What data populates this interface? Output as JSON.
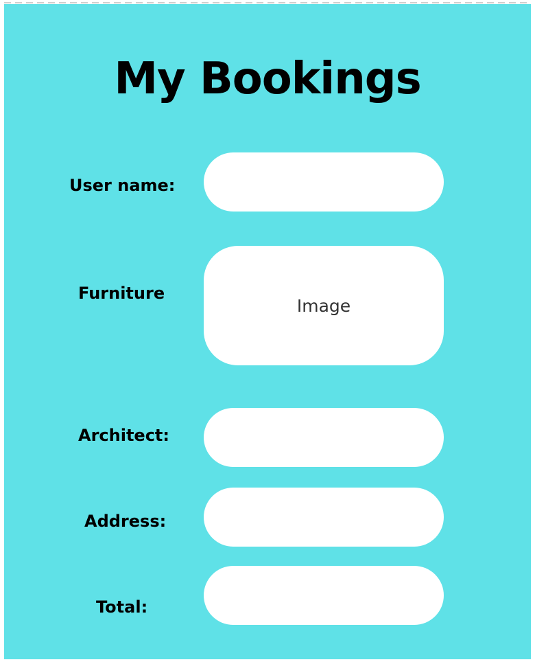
{
  "page": {
    "title": "My Bookings",
    "background_color": "#5fe1e7",
    "field_color": "#ffffff"
  },
  "form": {
    "username_label": "User name:",
    "username_value": "",
    "furniture_label": "Furniture",
    "furniture_image_text": "Image",
    "architect_label": "Architect:",
    "architect_value": "",
    "address_label": "Address:",
    "address_value": "",
    "total_label": "Total:",
    "total_value": ""
  }
}
